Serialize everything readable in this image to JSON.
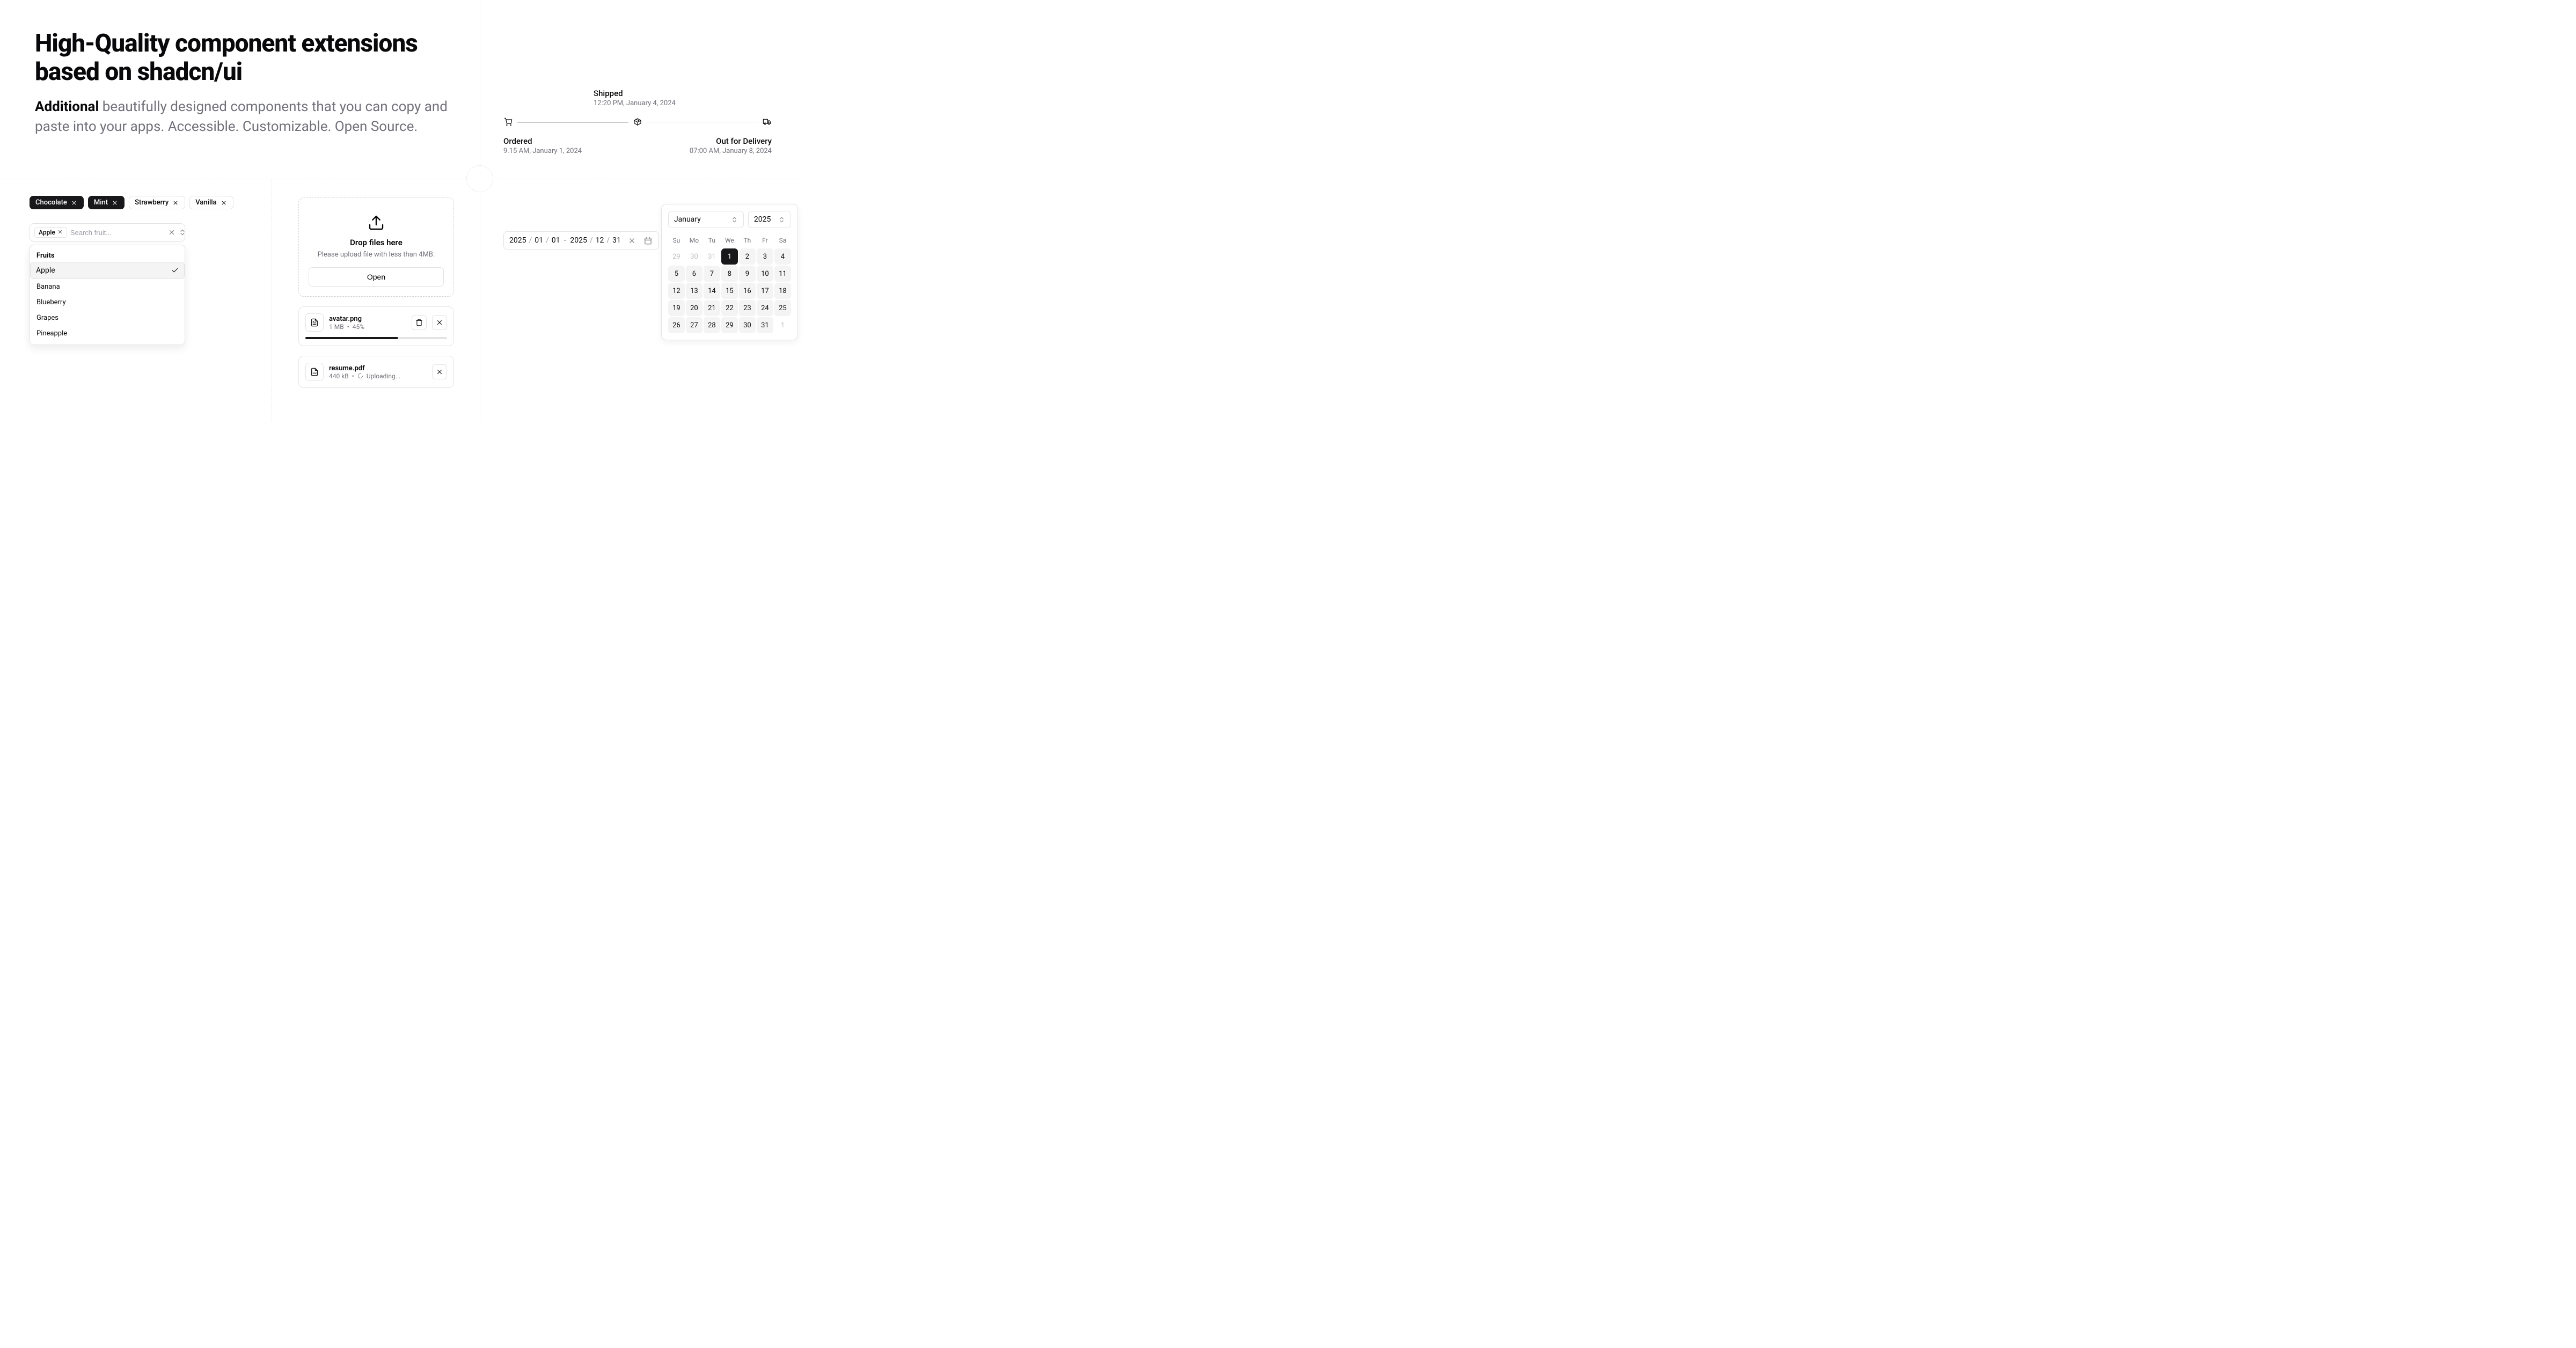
{
  "hero": {
    "title": "High-Quality component extensions based on shadcn/ui",
    "lead_strong": "Additional",
    "lead_rest": " beautifully designed components that you can copy and paste into your apps. Accessible. Customizable. Open Source."
  },
  "tags": [
    {
      "label": "Chocolate",
      "variant": "dark"
    },
    {
      "label": "Mint",
      "variant": "dark"
    },
    {
      "label": "Strawberry",
      "variant": "light"
    },
    {
      "label": "Vanilla",
      "variant": "light"
    }
  ],
  "combo": {
    "chip": "Apple",
    "placeholder": "Search fruit...",
    "group_label": "Fruits",
    "items": [
      {
        "label": "Apple",
        "selected": true
      },
      {
        "label": "Banana",
        "selected": false
      },
      {
        "label": "Blueberry",
        "selected": false
      },
      {
        "label": "Grapes",
        "selected": false
      },
      {
        "label": "Pineapple",
        "selected": false
      }
    ]
  },
  "dropzone": {
    "title": "Drop files here",
    "subtitle": "Please upload file with less than 4MB.",
    "button": "Open"
  },
  "files": [
    {
      "name": "avatar.png",
      "size": "1 MB",
      "pct": "45%",
      "progress": 65,
      "actions": [
        "trash",
        "x"
      ]
    },
    {
      "name": "resume.pdf",
      "size": "440 kB",
      "status": "Uploading...",
      "spinner": true,
      "actions": [
        "x"
      ]
    }
  ],
  "stepper": {
    "top": {
      "title": "Shipped",
      "time": "12:20 PM, January 4, 2024"
    },
    "left": {
      "title": "Ordered",
      "time": "9.15 AM, January 1, 2024"
    },
    "right": {
      "title": "Out for Delivery",
      "time": "07:00 AM, January 8, 2024"
    }
  },
  "daterange": {
    "from": {
      "y": "2025",
      "m": "01",
      "d": "01"
    },
    "to": {
      "y": "2025",
      "m": "12",
      "d": "31"
    }
  },
  "calendar": {
    "month": "January",
    "year": "2025",
    "dow": [
      "Su",
      "Mo",
      "Tu",
      "We",
      "Th",
      "Fr",
      "Sa"
    ],
    "cells": [
      {
        "n": "29",
        "cls": "out"
      },
      {
        "n": "30",
        "cls": "out"
      },
      {
        "n": "31",
        "cls": "out"
      },
      {
        "n": "1",
        "cls": "sel1"
      },
      {
        "n": "2",
        "cls": "range"
      },
      {
        "n": "3",
        "cls": "range"
      },
      {
        "n": "4",
        "cls": "range"
      },
      {
        "n": "5",
        "cls": "range"
      },
      {
        "n": "6",
        "cls": "range"
      },
      {
        "n": "7",
        "cls": "range"
      },
      {
        "n": "8",
        "cls": "range"
      },
      {
        "n": "9",
        "cls": "range"
      },
      {
        "n": "10",
        "cls": "range"
      },
      {
        "n": "11",
        "cls": "range"
      },
      {
        "n": "12",
        "cls": "range"
      },
      {
        "n": "13",
        "cls": "range"
      },
      {
        "n": "14",
        "cls": "range"
      },
      {
        "n": "15",
        "cls": "range"
      },
      {
        "n": "16",
        "cls": "range"
      },
      {
        "n": "17",
        "cls": "range"
      },
      {
        "n": "18",
        "cls": "range"
      },
      {
        "n": "19",
        "cls": "range"
      },
      {
        "n": "20",
        "cls": "range"
      },
      {
        "n": "21",
        "cls": "range"
      },
      {
        "n": "22",
        "cls": "range"
      },
      {
        "n": "23",
        "cls": "range"
      },
      {
        "n": "24",
        "cls": "range"
      },
      {
        "n": "25",
        "cls": "range"
      },
      {
        "n": "26",
        "cls": "range"
      },
      {
        "n": "27",
        "cls": "range"
      },
      {
        "n": "28",
        "cls": "range"
      },
      {
        "n": "29",
        "cls": "range"
      },
      {
        "n": "30",
        "cls": "range"
      },
      {
        "n": "31",
        "cls": "range"
      },
      {
        "n": "1",
        "cls": "out"
      }
    ]
  }
}
